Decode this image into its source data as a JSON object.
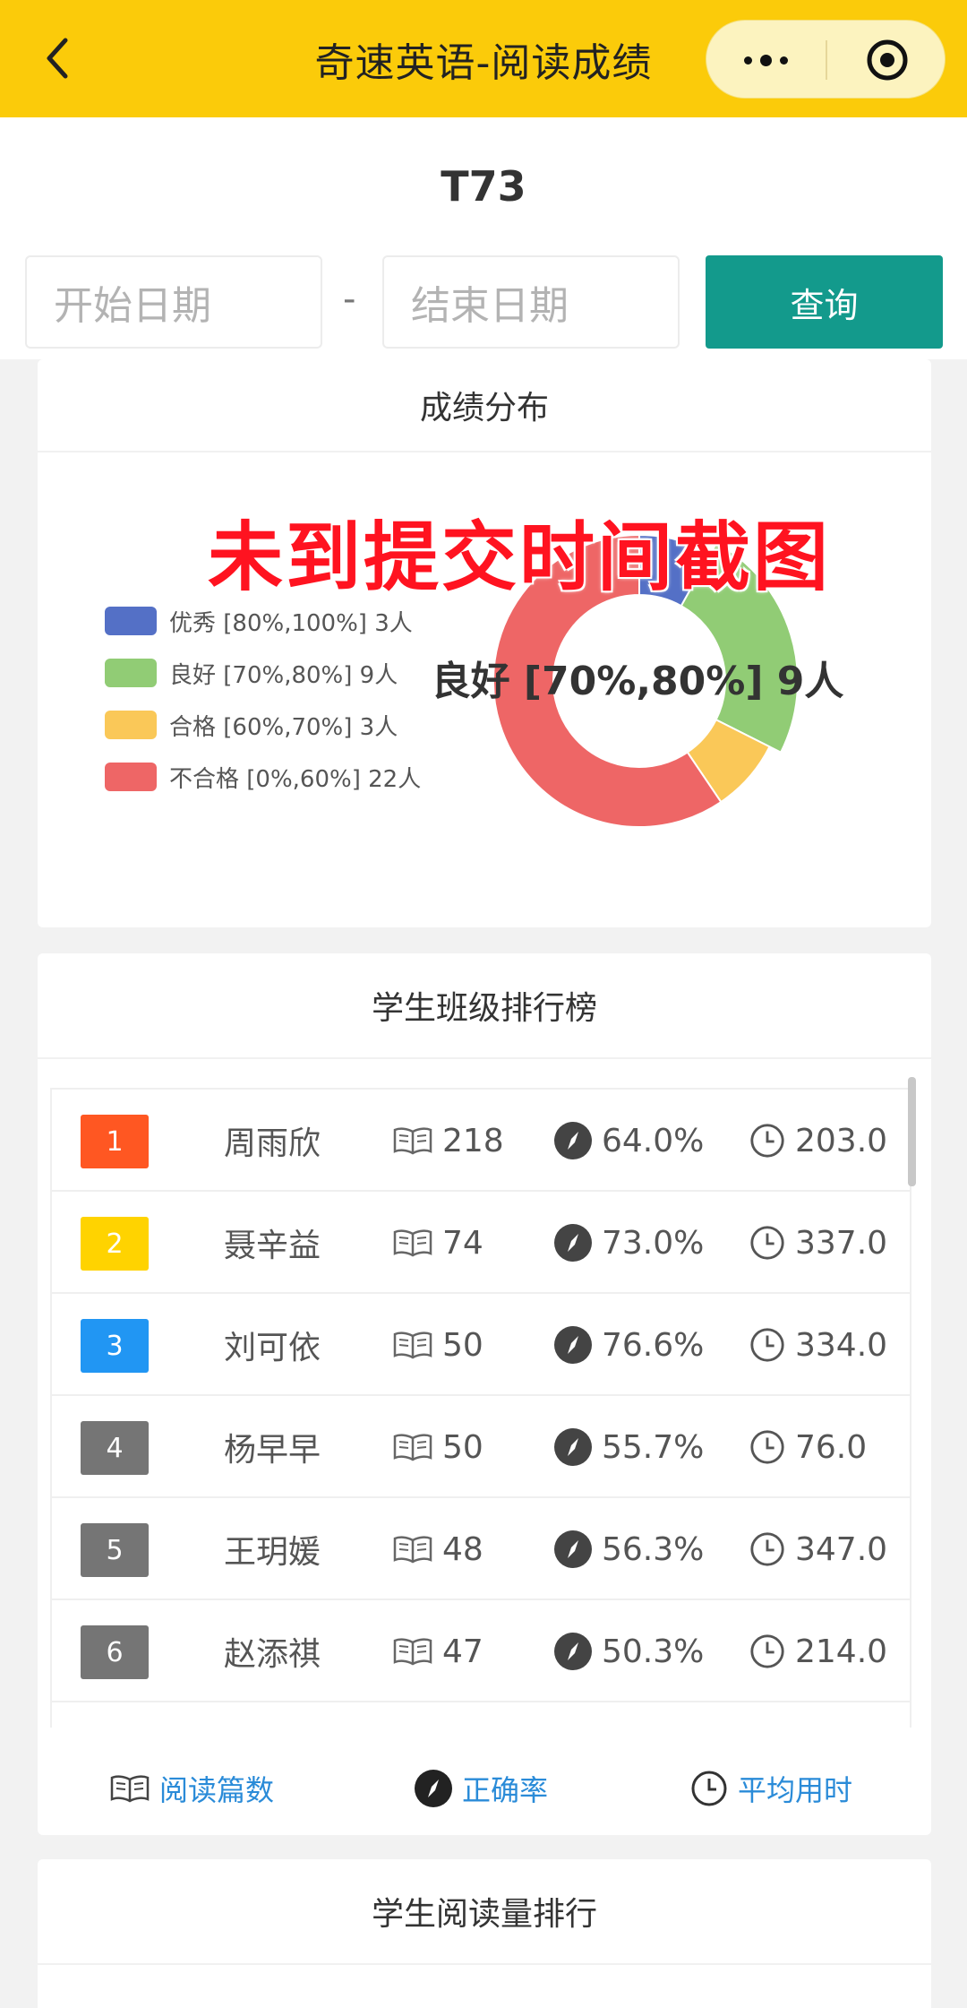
{
  "topbar": {
    "title": "奇速英语-阅读成绩"
  },
  "page": {
    "title": "T73"
  },
  "filter": {
    "start_placeholder": "开始日期",
    "separator": "-",
    "end_placeholder": "结束日期",
    "query_label": "查询"
  },
  "distribution": {
    "title": "成绩分布",
    "highlight_label": "良好 [70%,80%] 9人",
    "legend": [
      {
        "label": "优秀 [80%,100%] 3人",
        "color": "#5470c6"
      },
      {
        "label": "良好 [70%,80%] 9人",
        "color": "#91cc75"
      },
      {
        "label": "合格 [60%,70%] 3人",
        "color": "#fac858"
      },
      {
        "label": "不合格 [0%,60%] 22人",
        "color": "#ee6666"
      }
    ]
  },
  "chart_data": {
    "type": "pie",
    "categories": [
      "优秀 [80%,100%]",
      "良好 [70%,80%]",
      "合格 [60%,70%]",
      "不合格 [0%,60%]"
    ],
    "values": [
      3,
      9,
      3,
      22
    ],
    "colors": [
      "#5470c6",
      "#91cc75",
      "#fac858",
      "#ee6666"
    ],
    "highlighted": "良好 [70%,80%]",
    "legend_position": "left"
  },
  "watermark": "未到提交时间截图",
  "ranking": {
    "title": "学生班级排行榜",
    "rows": [
      {
        "rank": "1",
        "name": "周雨欣",
        "articles": "218",
        "accuracy": "64.0%",
        "avg_time": "203.0",
        "badge_color": "#ff5722"
      },
      {
        "rank": "2",
        "name": "聂辛益",
        "articles": "74",
        "accuracy": "73.0%",
        "avg_time": "337.0",
        "badge_color": "#ffd300"
      },
      {
        "rank": "3",
        "name": "刘可依",
        "articles": "50",
        "accuracy": "76.6%",
        "avg_time": "334.0",
        "badge_color": "#2196f3"
      },
      {
        "rank": "4",
        "name": "杨早早",
        "articles": "50",
        "accuracy": "55.7%",
        "avg_time": "76.0",
        "badge_color": "#757575"
      },
      {
        "rank": "5",
        "name": "王玥媛",
        "articles": "48",
        "accuracy": "56.3%",
        "avg_time": "347.0",
        "badge_color": "#757575"
      },
      {
        "rank": "6",
        "name": "赵添祺",
        "articles": "47",
        "accuracy": "50.3%",
        "avg_time": "214.0",
        "badge_color": "#757575"
      }
    ],
    "footer": {
      "articles_label": "阅读篇数",
      "accuracy_label": "正确率",
      "avg_time_label": "平均用时"
    }
  },
  "reading_rank": {
    "title": "学生阅读量排行"
  }
}
